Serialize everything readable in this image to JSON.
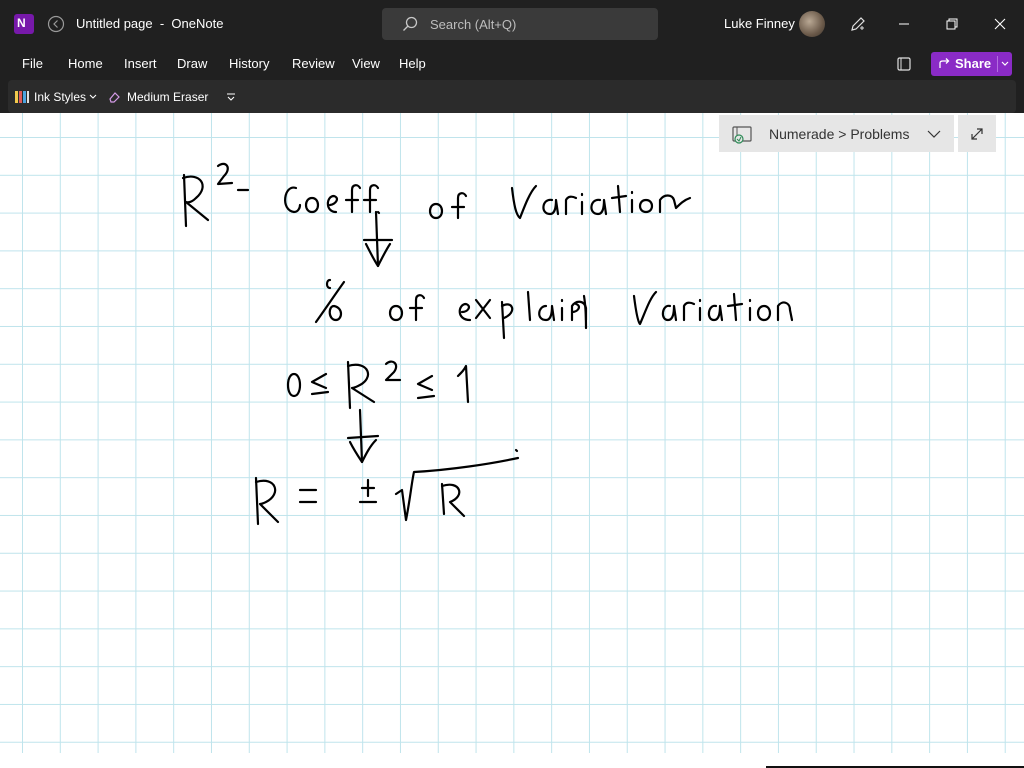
{
  "titlebar": {
    "page_title": "Untitled page  -  OneNote",
    "logo_letter": "N",
    "search_placeholder": "Search (Alt+Q)",
    "user_name": "Luke Finney"
  },
  "menu": {
    "items": [
      "File",
      "Home",
      "Insert",
      "Draw",
      "History",
      "Review",
      "View",
      "Help"
    ],
    "share_label": "Share"
  },
  "ribbon": {
    "ink_styles_label": "Ink Styles",
    "eraser_label": "Medium Eraser"
  },
  "notebook": {
    "location_label": "Numerade > Problems"
  },
  "canvas": {
    "background": "#ffffff",
    "grid_color": "#bfe4ec",
    "ink_color": "#000000",
    "handwritten_lines": [
      "R² - Coeff. of Variation",
      "% of explained Variation",
      "0 ≤ R² ≤ 1",
      "R = ± √R"
    ]
  },
  "colors": {
    "titlebar_bg": "#202020",
    "ribbon_bg": "#2b2b2b",
    "share_accent": "#8a2bc6",
    "app_purple": "#7719aa"
  }
}
